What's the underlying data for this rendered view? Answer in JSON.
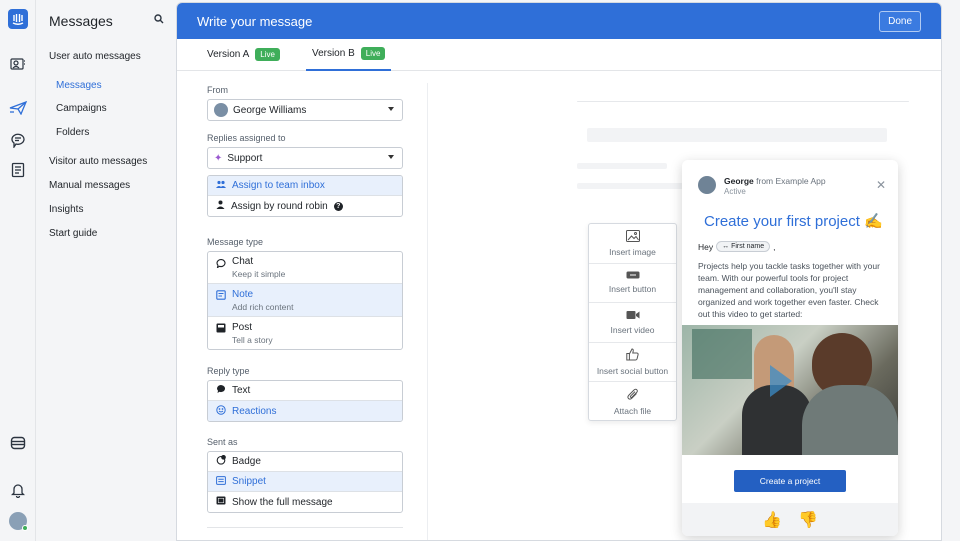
{
  "nav": {
    "title": "Messages",
    "items": [
      {
        "label": "User auto messages"
      },
      {
        "label": "Messages"
      },
      {
        "label": "Campaigns"
      },
      {
        "label": "Folders"
      },
      {
        "label": "Visitor auto messages"
      },
      {
        "label": "Manual messages"
      },
      {
        "label": "Insights"
      },
      {
        "label": "Start guide"
      }
    ]
  },
  "panel": {
    "title": "Write your message",
    "done_label": "Done",
    "tabs": [
      {
        "label": "Version A",
        "badge": "Live"
      },
      {
        "label": "Version B",
        "badge": "Live"
      }
    ]
  },
  "form": {
    "from_label": "From",
    "from_value": "George Williams",
    "replies_label": "Replies assigned to",
    "replies_value": "Support",
    "assign_options": [
      "Assign to team inbox",
      "Assign by round robin"
    ],
    "message_type_label": "Message type",
    "message_types": [
      {
        "title": "Chat",
        "desc": "Keep it simple"
      },
      {
        "title": "Note",
        "desc": "Add rich content"
      },
      {
        "title": "Post",
        "desc": "Tell a story"
      }
    ],
    "reply_type_label": "Reply type",
    "reply_types": [
      "Text",
      "Reactions"
    ],
    "sent_as_label": "Sent as",
    "sent_as": [
      "Badge",
      "Snippet",
      "Show the full message"
    ]
  },
  "insert_menu": [
    "Insert image",
    "Insert button",
    "Insert video",
    "Insert social button",
    "Attach file"
  ],
  "preview": {
    "sender_name": "George",
    "sender_from": "from Example App",
    "status": "Active",
    "title": "Create your first project ✍️",
    "hey": "Hey",
    "chip": "↔ First name",
    "comma": ",",
    "body": "Projects help you tackle tasks together with your team. With our powerful tools for project management and collaboration, you'll stay organized and work together even faster. Check out this video to get started:",
    "cta": "Create a project",
    "reactions": [
      "👍",
      "👎"
    ]
  }
}
